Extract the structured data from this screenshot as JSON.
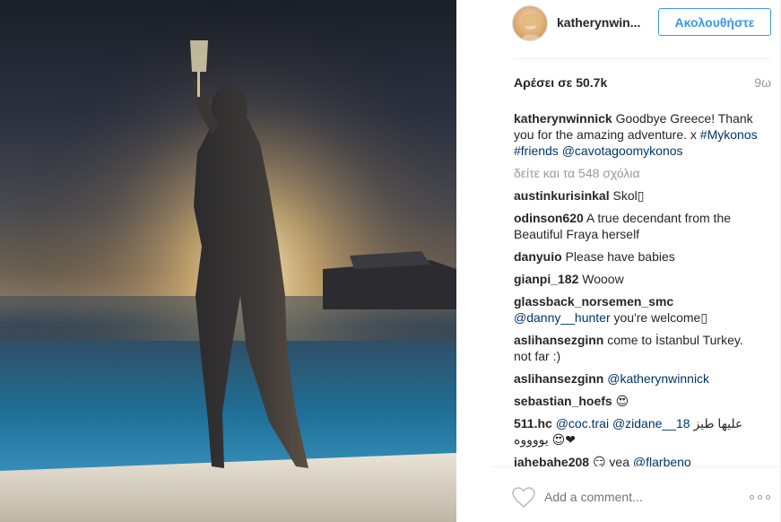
{
  "post": {
    "username": "katherynwin...",
    "follow_label": "Ακολουθήστε",
    "likes": "Αρέσει σε 50.7k",
    "time": "9ω"
  },
  "caption": {
    "user": "katherynwinnick",
    "text": " Goodbye Greece! Thank you for the amazing adventure. x ",
    "tags": [
      "#Mykonos",
      "#friends",
      "@cavotagoomykonos"
    ]
  },
  "view_all": "δείτε και τα 548 σχόλια",
  "comments": [
    {
      "user": "austinkurisinkal",
      "text": " Skol▯"
    },
    {
      "user": "odinson620",
      "text": " A true decendant from the Beautiful Fraya herself"
    },
    {
      "user": "danyuio",
      "text": " Please have babies"
    },
    {
      "user": "gianpi_182",
      "text": " Wooow"
    },
    {
      "user": "glassback_norsemen_smc",
      "tag": " @danny__hunter",
      "text": " you're welcome▯"
    },
    {
      "user": "aslihansezginn",
      "text": " come to İstanbul Turkey. not far :)"
    },
    {
      "user": "aslihansezginn",
      "tag": " @katherynwinnick",
      "text": ""
    },
    {
      "user": "sebastian_hoefs",
      "text": " 😍"
    },
    {
      "user": "511.hc",
      "tag": " @coc.trai @zidane__18",
      "text": " عليها طيز يووووه 😍❤"
    },
    {
      "user": "iahebahe208",
      "text": " 😏 yea ",
      "tag2": "@flarbeno"
    }
  ],
  "footer": {
    "comment_placeholder": "Add a comment..."
  },
  "icons": {
    "heart": "heart-outline-icon",
    "more": "more-options-icon"
  },
  "colors": {
    "accent": "#3897f0",
    "tag": "#003569",
    "muted": "#999999"
  }
}
